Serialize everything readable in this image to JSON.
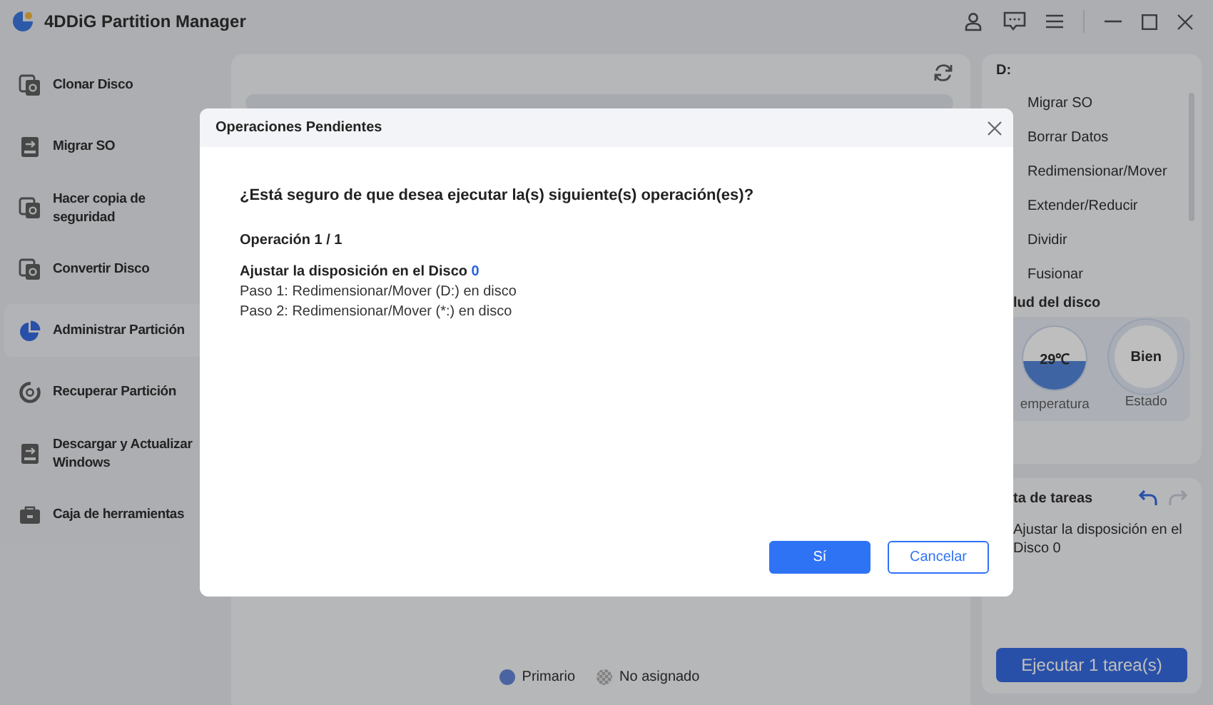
{
  "window": {
    "title": "4DDiG Partition Manager"
  },
  "sidebar": {
    "items": [
      {
        "label": "Clonar Disco",
        "selected": false
      },
      {
        "label": "Migrar SO",
        "selected": false
      },
      {
        "label": "Hacer copia de seguridad",
        "selected": false
      },
      {
        "label": "Convertir Disco",
        "selected": false
      },
      {
        "label": "Administrar Partición",
        "selected": true
      },
      {
        "label": "Recuperar Partición",
        "selected": false
      },
      {
        "label": "Descargar y Actualizar Windows",
        "selected": false
      },
      {
        "label": "Caja de herramientas",
        "selected": false
      }
    ]
  },
  "legend": [
    {
      "label": "Primario",
      "kind": "primary"
    },
    {
      "label": "No asignado",
      "kind": "unallocated"
    }
  ],
  "partition_panel": {
    "drive": "D:",
    "actions": [
      "Migrar SO",
      "Borrar Datos",
      "Redimensionar/Mover",
      "Extender/Reducir",
      "Dividir",
      "Fusionar"
    ]
  },
  "health": {
    "title": "lud del disco",
    "temperature": {
      "value": "29℃",
      "label": "emperatura"
    },
    "status": {
      "value": "Bien",
      "label": "Estado"
    }
  },
  "tasks": {
    "title": "ta de tareas",
    "undo_disabled": false,
    "redo_disabled": true,
    "items": [
      "Ajustar la disposición en el Disco 0"
    ],
    "run_button": "Ejecutar 1 tarea(s)"
  },
  "dialog": {
    "title": "Operaciones Pendientes",
    "question": "¿Está seguro de que desea ejecutar la(s) siguiente(s) operación(es)?",
    "operation": "Operación 1 / 1",
    "heading": "Ajustar la disposición en el Disco",
    "disk": "0",
    "steps": [
      "Paso 1: Redimensionar/Mover (D:) en disco",
      "Paso 2: Redimensionar/Mover (*:) en disco"
    ],
    "confirm": "Sí",
    "cancel": "Cancelar"
  }
}
